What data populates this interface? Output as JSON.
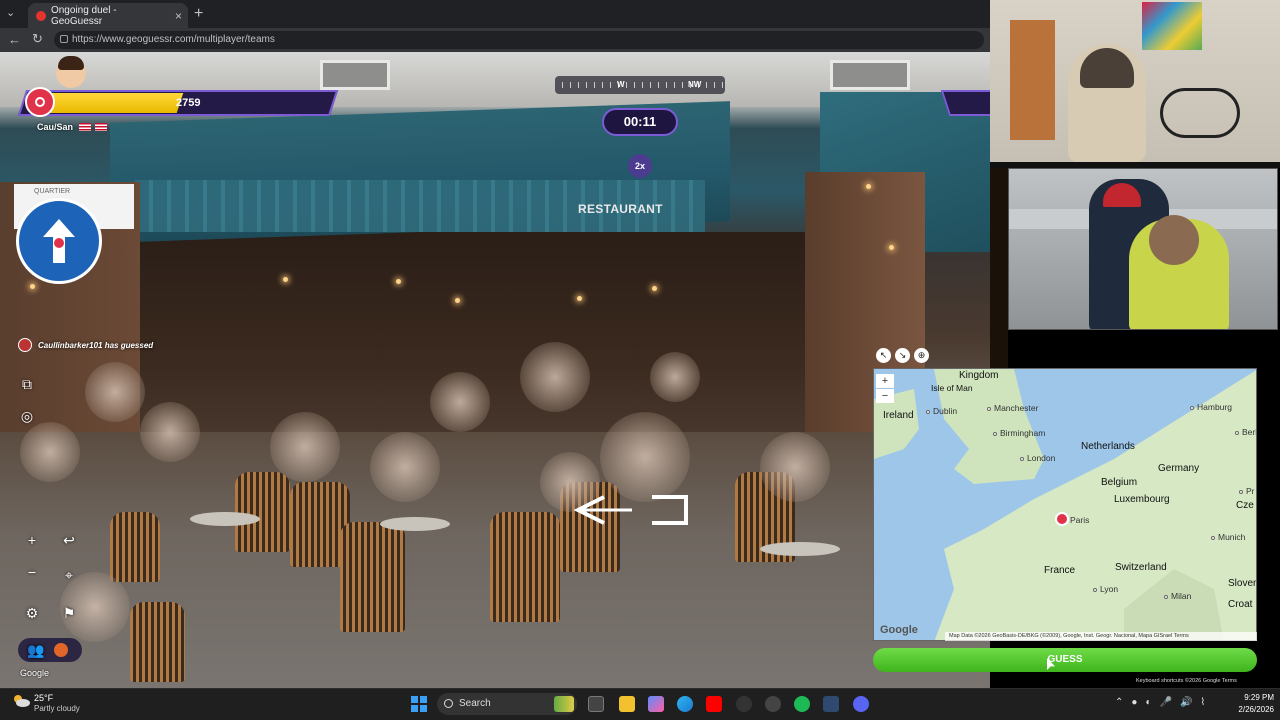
{
  "browser": {
    "tab_title": "Ongoing duel - GeoGuessr",
    "new_tab": "+",
    "url": "https://www.geoguessr.com/multiplayer/teams"
  },
  "hud": {
    "health": "2759",
    "health_fraction": 0.44,
    "team_name": "Cau/San",
    "timer": "00:11",
    "multiplier": "2x",
    "compass_w": "W",
    "compass_nw": "NW",
    "guess_notification": "Caullinbarker101 has guessed"
  },
  "scene": {
    "awning_sign": "RESTAURANT",
    "corner_sign": "QUARTIER",
    "sv_logo": "Google"
  },
  "map": {
    "countries": {
      "kingdom": "Kingdom",
      "isle_of_man": "Isle of Man",
      "ireland": "Ireland",
      "netherlands": "Netherlands",
      "germany": "Germany",
      "belgium": "Belgium",
      "luxembourg": "Luxembourg",
      "france": "France",
      "switzerland": "Switzerland",
      "slovenia": "Sloven",
      "croatia": "Croat",
      "czechia": "Cze"
    },
    "cities": {
      "dublin": "Dublin",
      "manchester": "Manchester",
      "birmingham": "Birmingham",
      "london": "London",
      "hamburg": "Hamburg",
      "berlin": "Berlin",
      "paris": "Paris",
      "munich": "Munich",
      "lyon": "Lyon",
      "milan": "Milan",
      "prague": "Pr"
    },
    "google_logo": "Google",
    "attribution": "Map Data ©2026 GeoBasis-DE/BKG (©2009), Google, Inst. Geogr. Nacional, Mapa GISrael   Terms",
    "guess_button": "GUESS",
    "shortcuts": "Keyboard shortcuts   ©2026 Google   Terms"
  },
  "taskbar": {
    "temp": "25°F",
    "weather": "Partly cloudy",
    "search_placeholder": "Search",
    "time": "9:29 PM",
    "date": "2/26/2026"
  },
  "colors": {
    "accent_purple": "#7b5cd6",
    "health_yellow": "#ffd83a",
    "guess_green": "#4fc02a",
    "team_red": "#e0334a"
  }
}
